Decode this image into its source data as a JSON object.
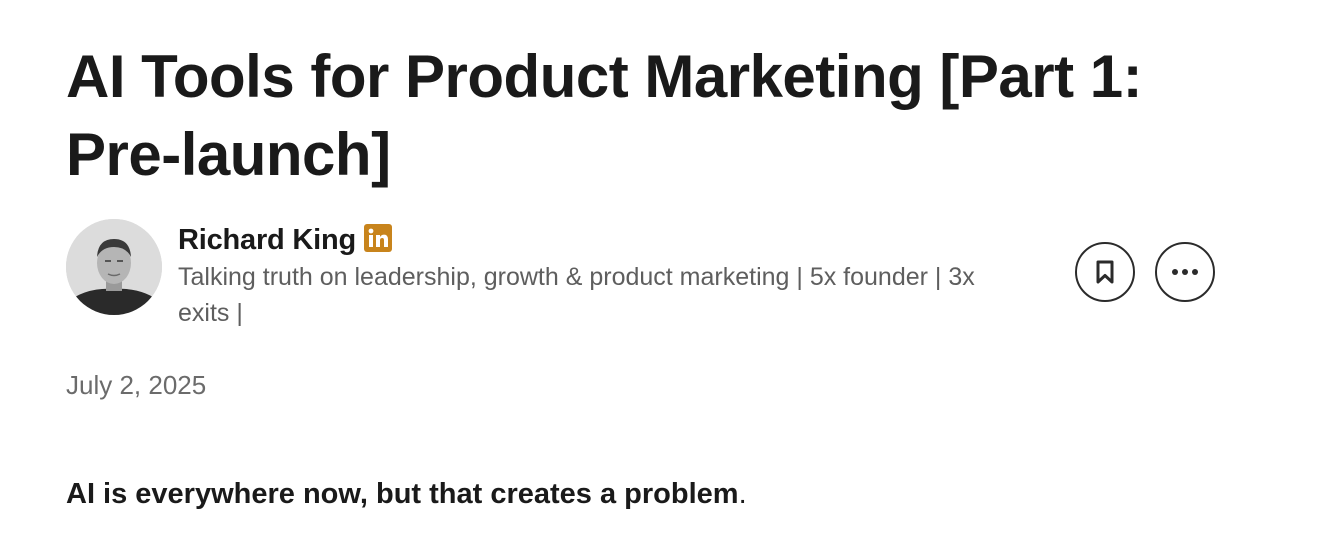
{
  "article": {
    "title": "AI Tools for Product Marketing [Part 1: Pre-launch]",
    "published_date": "July 2, 2025",
    "lead_bold": "AI is everywhere now, but that creates a problem",
    "lead_tail": "."
  },
  "author": {
    "name": "Richard King",
    "badge_icon": "linkedin-icon",
    "badge_color": "#c8841c",
    "headline": "Talking truth on leadership, growth & product marketing | 5x founder | 3x exits |"
  },
  "actions": {
    "save_icon": "bookmark-icon",
    "more_icon": "more-horizontal-icon"
  }
}
